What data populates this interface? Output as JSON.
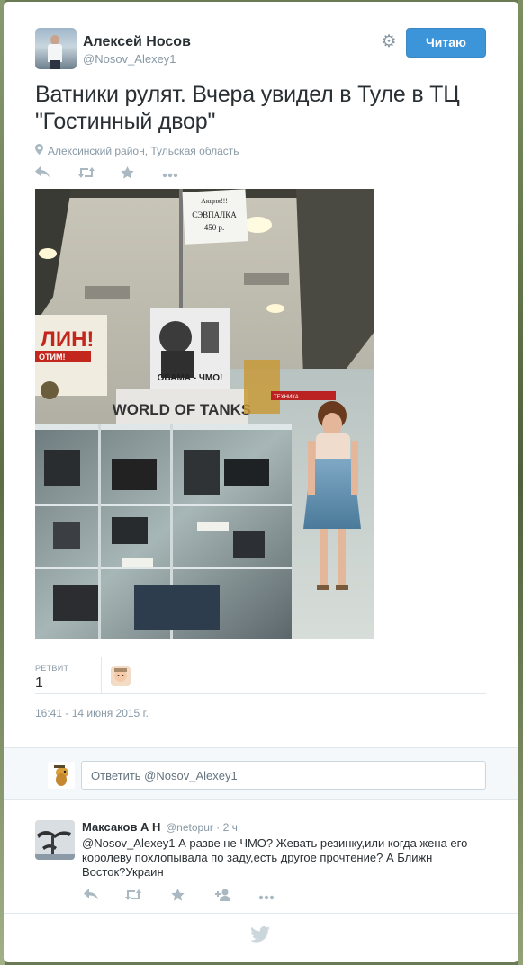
{
  "tweet": {
    "author_name": "Алексей Носов",
    "author_handle": "@Nosov_Alexey1",
    "follow_label": "Читаю",
    "text": "Ватники рулят. Вчера увидел в Туле в ТЦ \"Гостинный двор\"",
    "location": "Алексинский район, Тульская область",
    "retweet_label": "РЕТВИТ",
    "retweet_count": "1",
    "timestamp": "16:41 - 14 июня 2015 г."
  },
  "photo": {
    "sign_lines": [
      "Акция!!!",
      "СЭВПАЛКА",
      "450 р."
    ],
    "poster_text": "ОБАМА - ЧМО!",
    "banner_text": "WORLD OF TANKS",
    "left_sign": "ЛИН!",
    "left_sign_sub": "ОТИМ!",
    "store_sign": "ТЕХНИКА"
  },
  "reply_box": {
    "placeholder": "Ответить @Nosov_Alexey1"
  },
  "reply": {
    "name": "Максаков А Н",
    "handle": "@netopur",
    "time": "· 2 ч",
    "text": "@Nosov_Alexey1 А разве не ЧМО? Жевать резинку,или когда жена его королеву похлопывала по заду,есть другое прочтение? А Ближн Восток?Украин"
  },
  "icons": [
    "location-pin-icon",
    "reply-icon",
    "retweet-icon",
    "favorite-icon",
    "more-icon",
    "follow-user-icon",
    "gear-icon",
    "twitter-bird-icon"
  ],
  "colors": {
    "accent": "#3c94d9",
    "muted": "#8899a6",
    "text": "#292f33"
  }
}
